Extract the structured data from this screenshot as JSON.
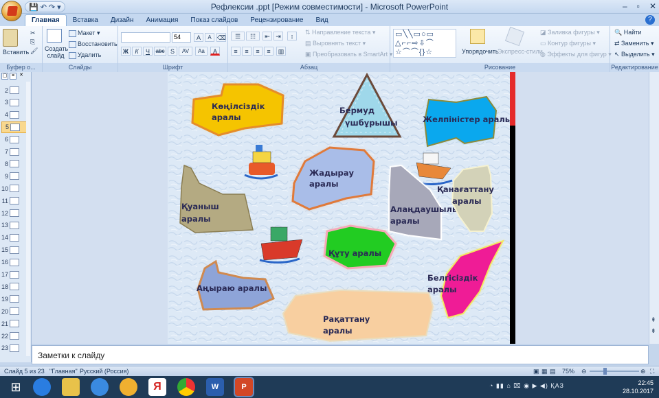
{
  "window": {
    "title": "Рефлексии .ppt [Режим совместимости] - Microsoft PowerPoint",
    "controls": [
      "–",
      "▫",
      "✕"
    ]
  },
  "quick_access": {
    "items": [
      "💾",
      "↶",
      "↷",
      "▾"
    ]
  },
  "tabs": [
    "Главная",
    "Вставка",
    "Дизайн",
    "Анимация",
    "Показ слайдов",
    "Рецензирование",
    "Вид"
  ],
  "ribbon": {
    "clipboard": {
      "paste": "Вставить",
      "label": "Буфер о..."
    },
    "slides": {
      "new_slide": "Создать слайд",
      "layout": "Макет",
      "reset": "Восстановить",
      "delete": "Удалить",
      "label": "Слайды"
    },
    "font": {
      "size": "54",
      "grow": "A",
      "shrink": "A",
      "bold": "Ж",
      "italic": "К",
      "underline": "Ч",
      "strike": "abc",
      "shadow": "S",
      "spacing": "AV",
      "case": "Aa",
      "color": "A",
      "label": "Шрифт"
    },
    "paragraph": {
      "text_direction": "Направление текста",
      "align_text": "Выровнять текст",
      "smartart": "Преобразовать в SmartArt",
      "label": "Абзац"
    },
    "drawing": {
      "arrange": "Упорядочить",
      "quick_styles": "Экспресс-стили",
      "fill": "Заливка фигуры",
      "outline": "Контур фигуры",
      "effects": "Эффекты для фигур",
      "label": "Рисование"
    },
    "editing": {
      "find": "Найти",
      "replace": "Заменить",
      "select": "Выделить",
      "label": "Редактирование"
    }
  },
  "slide_thumbnails": [
    "2",
    "3",
    "4",
    "5",
    "6",
    "7",
    "8",
    "9",
    "10",
    "11",
    "12",
    "13",
    "14",
    "15",
    "16",
    "17",
    "18",
    "19",
    "20",
    "21",
    "22",
    "23"
  ],
  "selected_slide": "5",
  "slide": {
    "islands": [
      {
        "label_lines": [
          "Көңілсіздік",
          "аралы"
        ],
        "color": "#f5c400"
      },
      {
        "label_lines": [
          "Бермуд",
          "үшбұрышы"
        ],
        "color": "#8fd0e6"
      },
      {
        "label_lines": [
          "Желпіністер аралы"
        ],
        "color": "#0aa8ee"
      },
      {
        "label_lines": [
          "Жадырау",
          "аралы"
        ],
        "color": "#a9bde8"
      },
      {
        "label_lines": [
          "Алаңдаушылық",
          "аралы"
        ],
        "color": "#a7a8b9"
      },
      {
        "label_lines": [
          "Қанағаттану",
          "аралы"
        ],
        "color": "#d3d2b8"
      },
      {
        "label_lines": [
          "Қуаныш",
          "аралы"
        ],
        "color": "#b4aa82"
      },
      {
        "label_lines": [
          "Құту аралы"
        ],
        "color": "#22cc22"
      },
      {
        "label_lines": [
          "Аңыраю аралы"
        ],
        "color": "#8ea4d8"
      },
      {
        "label_lines": [
          "Белгісіздік",
          "аралы"
        ],
        "color": "#ef1c96"
      },
      {
        "label_lines": [
          "Рақаттану",
          "аралы"
        ],
        "color": "#f8cfa0"
      }
    ]
  },
  "notes": {
    "placeholder": "Заметки к слайду"
  },
  "status": {
    "slide_info": "Слайд 5 из 23",
    "theme": "\"Главная\"",
    "language": "Русский (Россия)",
    "zoom": "75%"
  },
  "taskbar": {
    "time": "22:45",
    "date": "28.10.2017",
    "lang": "ҚАЗ"
  },
  "colors": {
    "red_bar": "#e52b2b",
    "selected_thumb": "#f9d88e"
  }
}
